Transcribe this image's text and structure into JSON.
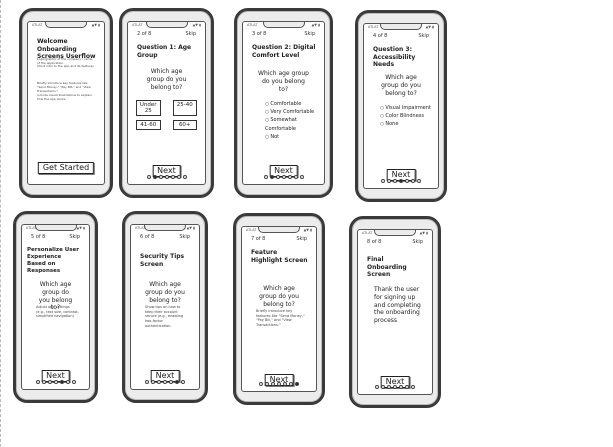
{
  "status": {
    "time": "ATLAT",
    "signal": "▲▼ ▮"
  },
  "welcome": {
    "title": "Welcome Onboarding Screens Userflow",
    "intro": "Logo/graphic of the company / name of the application",
    "line2": "Short intro to the app and its features",
    "note": "Briefly introduce key features like \"Send Money,\" \"Pay Bill,\" and \"View Transactions.\"",
    "note2": "Include visual illustrations to explain how the app works.",
    "button": "Get Started"
  },
  "q1": {
    "step": "2 of 8",
    "skip": "Skip",
    "title": "Question 1: Age Group",
    "question": "Which age group do you belong to?",
    "options": [
      "Under 25",
      "25-40",
      "41-60",
      "60+"
    ],
    "button": "Next"
  },
  "q2": {
    "step": "3 of 8",
    "skip": "Skip",
    "title": "Question 2: Digital Comfort Level",
    "question": "Which age group do you belong to?",
    "options": [
      "Comfortable",
      "Very Comfortable",
      "Somewhat Comfortable",
      "Not"
    ],
    "button": "Next"
  },
  "q3": {
    "step": "4 of 8",
    "skip": "Skip",
    "title": "Question 3: Accessibility Needs",
    "question": "Which age group do you belong to?",
    "options": [
      "Visual Impairment",
      "Color Blindness",
      "None"
    ],
    "button": "Next"
  },
  "personalize": {
    "step": "5 of 8",
    "skip": "Skip",
    "title": "Personalize User Experience Based on Responses",
    "question": "Which age group do you belong to?",
    "desc": "Adjust app settings (e.g., text size, contrast, simplified navigation)",
    "button": "Next"
  },
  "security": {
    "step": "6 of 8",
    "skip": "Skip",
    "title": "Security Tips Screen",
    "question": "Which age group do you belong to?",
    "desc": "Show tips on how to keep their account secure (e.g., enabling two-factor authentication.",
    "button": "Next"
  },
  "feature": {
    "step": "7 of 8",
    "skip": "Skip",
    "title": "Feature Highlight Screen",
    "question": "Which age group do you belong to?",
    "desc": "Briefly introduce key features like \"Send Money,\" \"Pay Bill,\" and \"View Transactions.\"",
    "button": "Next"
  },
  "final": {
    "step": "8 of 8",
    "skip": "Skip",
    "title": "Final Onboarding Screen",
    "message": "Thank the user for signing up and completing the onboarding process",
    "button": "Next"
  }
}
